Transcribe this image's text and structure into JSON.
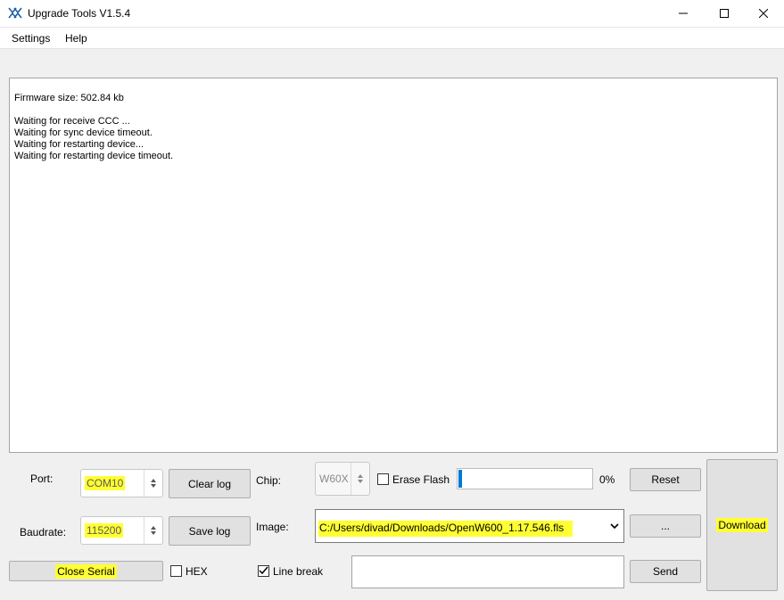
{
  "window": {
    "title": "Upgrade Tools V1.5.4",
    "minimize_icon": "minimize-icon",
    "maximize_icon": "maximize-icon",
    "close_icon": "close-icon"
  },
  "menu": {
    "settings": "Settings",
    "help": "Help"
  },
  "log": {
    "lines": "Firmware size: 502.84 kb\n\nWaiting for receive CCC ...\nWaiting for sync device timeout.\nWaiting for restarting device...\nWaiting for restarting device timeout."
  },
  "controls": {
    "port_label": "Port:",
    "port_value": "COM10",
    "baudrate_label": "Baudrate:",
    "baudrate_value": "115200",
    "clear_log": "Clear log",
    "save_log": "Save log",
    "chip_label": "Chip:",
    "chip_value": "W60X",
    "erase_flash_label": "Erase Flash",
    "erase_flash_checked": false,
    "progress_percent_text": "0%",
    "progress_fraction": 0.0,
    "reset": "Reset",
    "image_label": "Image:",
    "image_value": "C:/Users/divad/Downloads/OpenW600_1.17.546.fls",
    "browse": "...",
    "download": "Download",
    "close_serial": "Close Serial",
    "hex_label": "HEX",
    "hex_checked": false,
    "line_break_label": "Line break",
    "line_break_checked": true,
    "send_input_value": "",
    "send": "Send"
  },
  "colors": {
    "highlight": "#ffff33",
    "progress_accent": "#0078d7"
  }
}
